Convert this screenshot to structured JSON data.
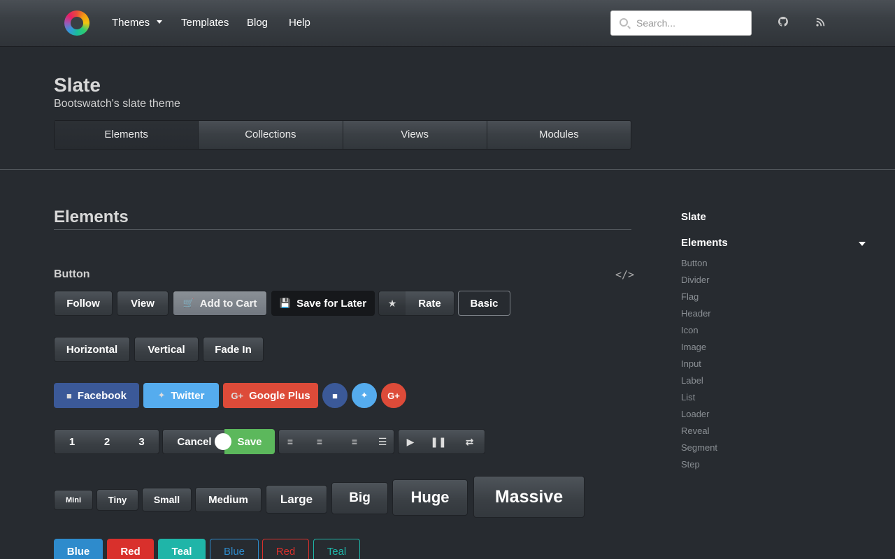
{
  "nav": {
    "items": [
      "Themes",
      "Templates",
      "Blog",
      "Help"
    ],
    "search_placeholder": "Search..."
  },
  "header": {
    "title": "Slate",
    "subtitle": "Bootswatch's slate theme",
    "tabs": [
      "Elements",
      "Collections",
      "Views",
      "Modules"
    ],
    "active_tab": "Elements"
  },
  "main": {
    "section_title": "Elements",
    "sub_title": "Button",
    "row1": {
      "follow": "Follow",
      "view": "View",
      "add_to_cart": "Add to Cart",
      "save_for_later": "Save for Later",
      "rate": "Rate",
      "basic": "Basic"
    },
    "row2": {
      "horizontal": "Horizontal",
      "vertical": "Vertical",
      "fade_in": "Fade In"
    },
    "row3": {
      "facebook": "Facebook",
      "twitter": "Twitter",
      "google_plus": "Google Plus"
    },
    "row4": {
      "pages": [
        "1",
        "2",
        "3"
      ],
      "cancel": "Cancel",
      "save": "Save"
    },
    "sizes": [
      "Mini",
      "Tiny",
      "Small",
      "Medium",
      "Large",
      "Big",
      "Huge",
      "Massive"
    ],
    "colors": [
      "Blue",
      "Red",
      "Teal",
      "Blue",
      "Red",
      "Teal"
    ]
  },
  "sidebar": {
    "title": "Slate",
    "section": "Elements",
    "links": [
      "Button",
      "Divider",
      "Flag",
      "Header",
      "Icon",
      "Image",
      "Input",
      "Label",
      "List",
      "Loader",
      "Reveal",
      "Segment",
      "Step"
    ]
  },
  "colors": {
    "background": "#272b30",
    "facebook": "#3b5998",
    "twitter": "#55acee",
    "google_plus": "#dd4b39",
    "save": "#5cb85c",
    "blue": "#2e8bcc",
    "red": "#d9302c",
    "teal": "#1fb5a8"
  }
}
